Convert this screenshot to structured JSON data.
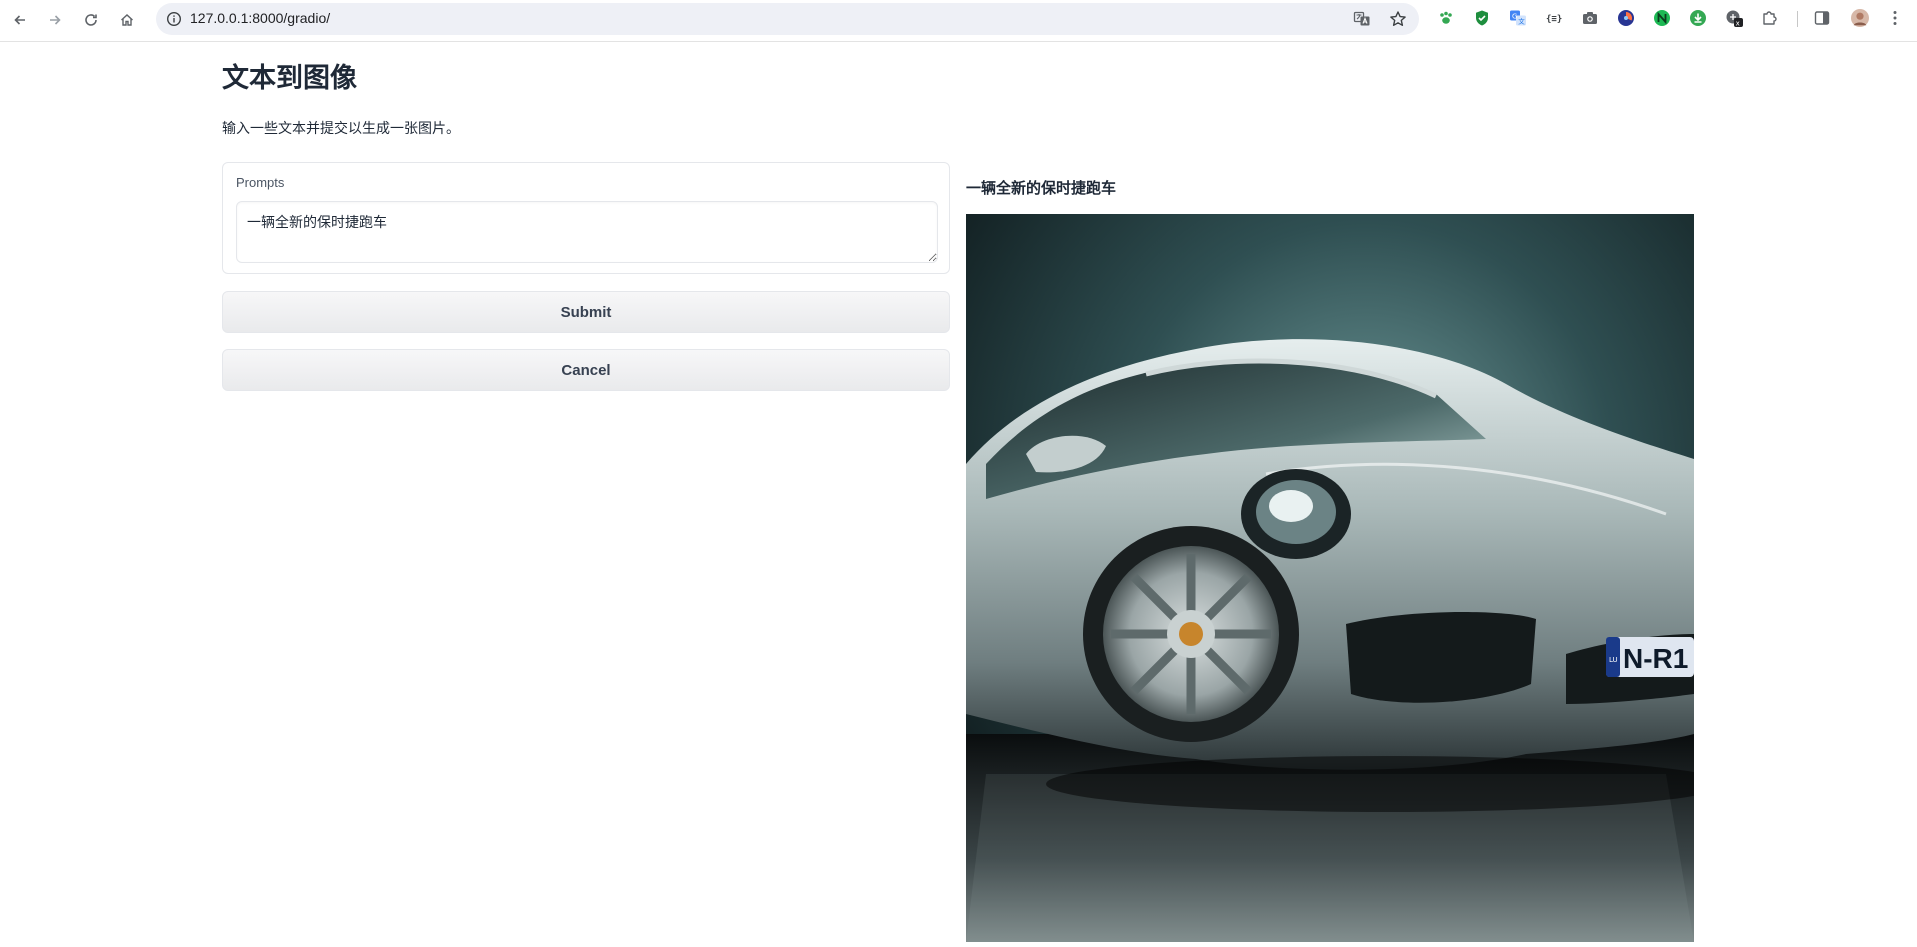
{
  "browser": {
    "url": "127.0.0.1:8000/gradio/",
    "nav_icons": [
      "back-icon",
      "forward-icon",
      "reload-icon",
      "home-icon"
    ],
    "omnibox_icons": [
      "site-info-icon",
      "translate-icon",
      "bookmark-star-icon"
    ],
    "extension_icons": [
      "paw-extension-icon",
      "shield-extension-icon",
      "translate-extension-icon",
      "code-extension-icon",
      "camera-extension-icon",
      "blue-circle-extension-icon",
      "green-n-extension-icon",
      "download-extension-icon",
      "puzzle-badge-extension-icon",
      "extensions-puzzle-icon"
    ],
    "right_icons": [
      "side-panel-icon",
      "profile-avatar",
      "menu-kebab-icon"
    ]
  },
  "app": {
    "title": "文本到图像",
    "description": "输入一些文本并提交以生成一张图片。"
  },
  "prompt": {
    "label": "Prompts",
    "value": "一辆全新的保时捷跑车"
  },
  "buttons": {
    "submit_label": "Submit",
    "cancel_label": "Cancel"
  },
  "output": {
    "label": "一辆全新的保时捷跑车",
    "image_alt": "silver-porsche-sports-car",
    "plate_text": "N-R1",
    "plate_country": "LU"
  },
  "colors": {
    "text": "#1f2937",
    "button_bg": "#e9eaec",
    "border": "#e5e7eb",
    "omnibox": "#eef0f6"
  }
}
